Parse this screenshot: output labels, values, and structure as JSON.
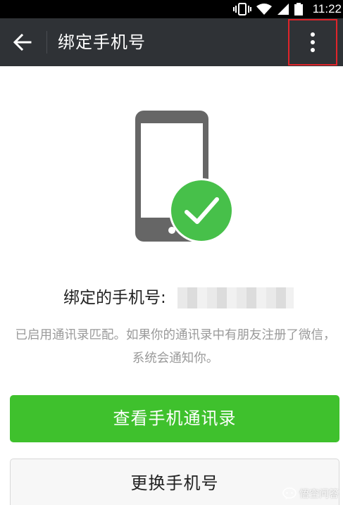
{
  "status_bar": {
    "time": "11:22",
    "icons": [
      "vibrate-icon",
      "wifi-icon",
      "signal-icon",
      "battery-icon"
    ]
  },
  "app_bar": {
    "title": "绑定手机号",
    "back_icon": "arrow-left-icon",
    "more_icon": "more-vertical-icon"
  },
  "bound": {
    "label": "绑定的手机号:",
    "number": ""
  },
  "description": "已启用通讯录匹配。如果你的通讯录中有朋友注册了微信，系统会通知你。",
  "actions": {
    "view_contacts_label": "查看手机通讯录",
    "change_phone_label": "更换手机号"
  },
  "watermark": {
    "text": "悟空问答"
  },
  "colors": {
    "app_bar": "#2f3236",
    "accent_green": "#3fc12d",
    "check_green": "#47c04a",
    "phone_gray": "#666666",
    "highlight_red": "#e0242a"
  }
}
